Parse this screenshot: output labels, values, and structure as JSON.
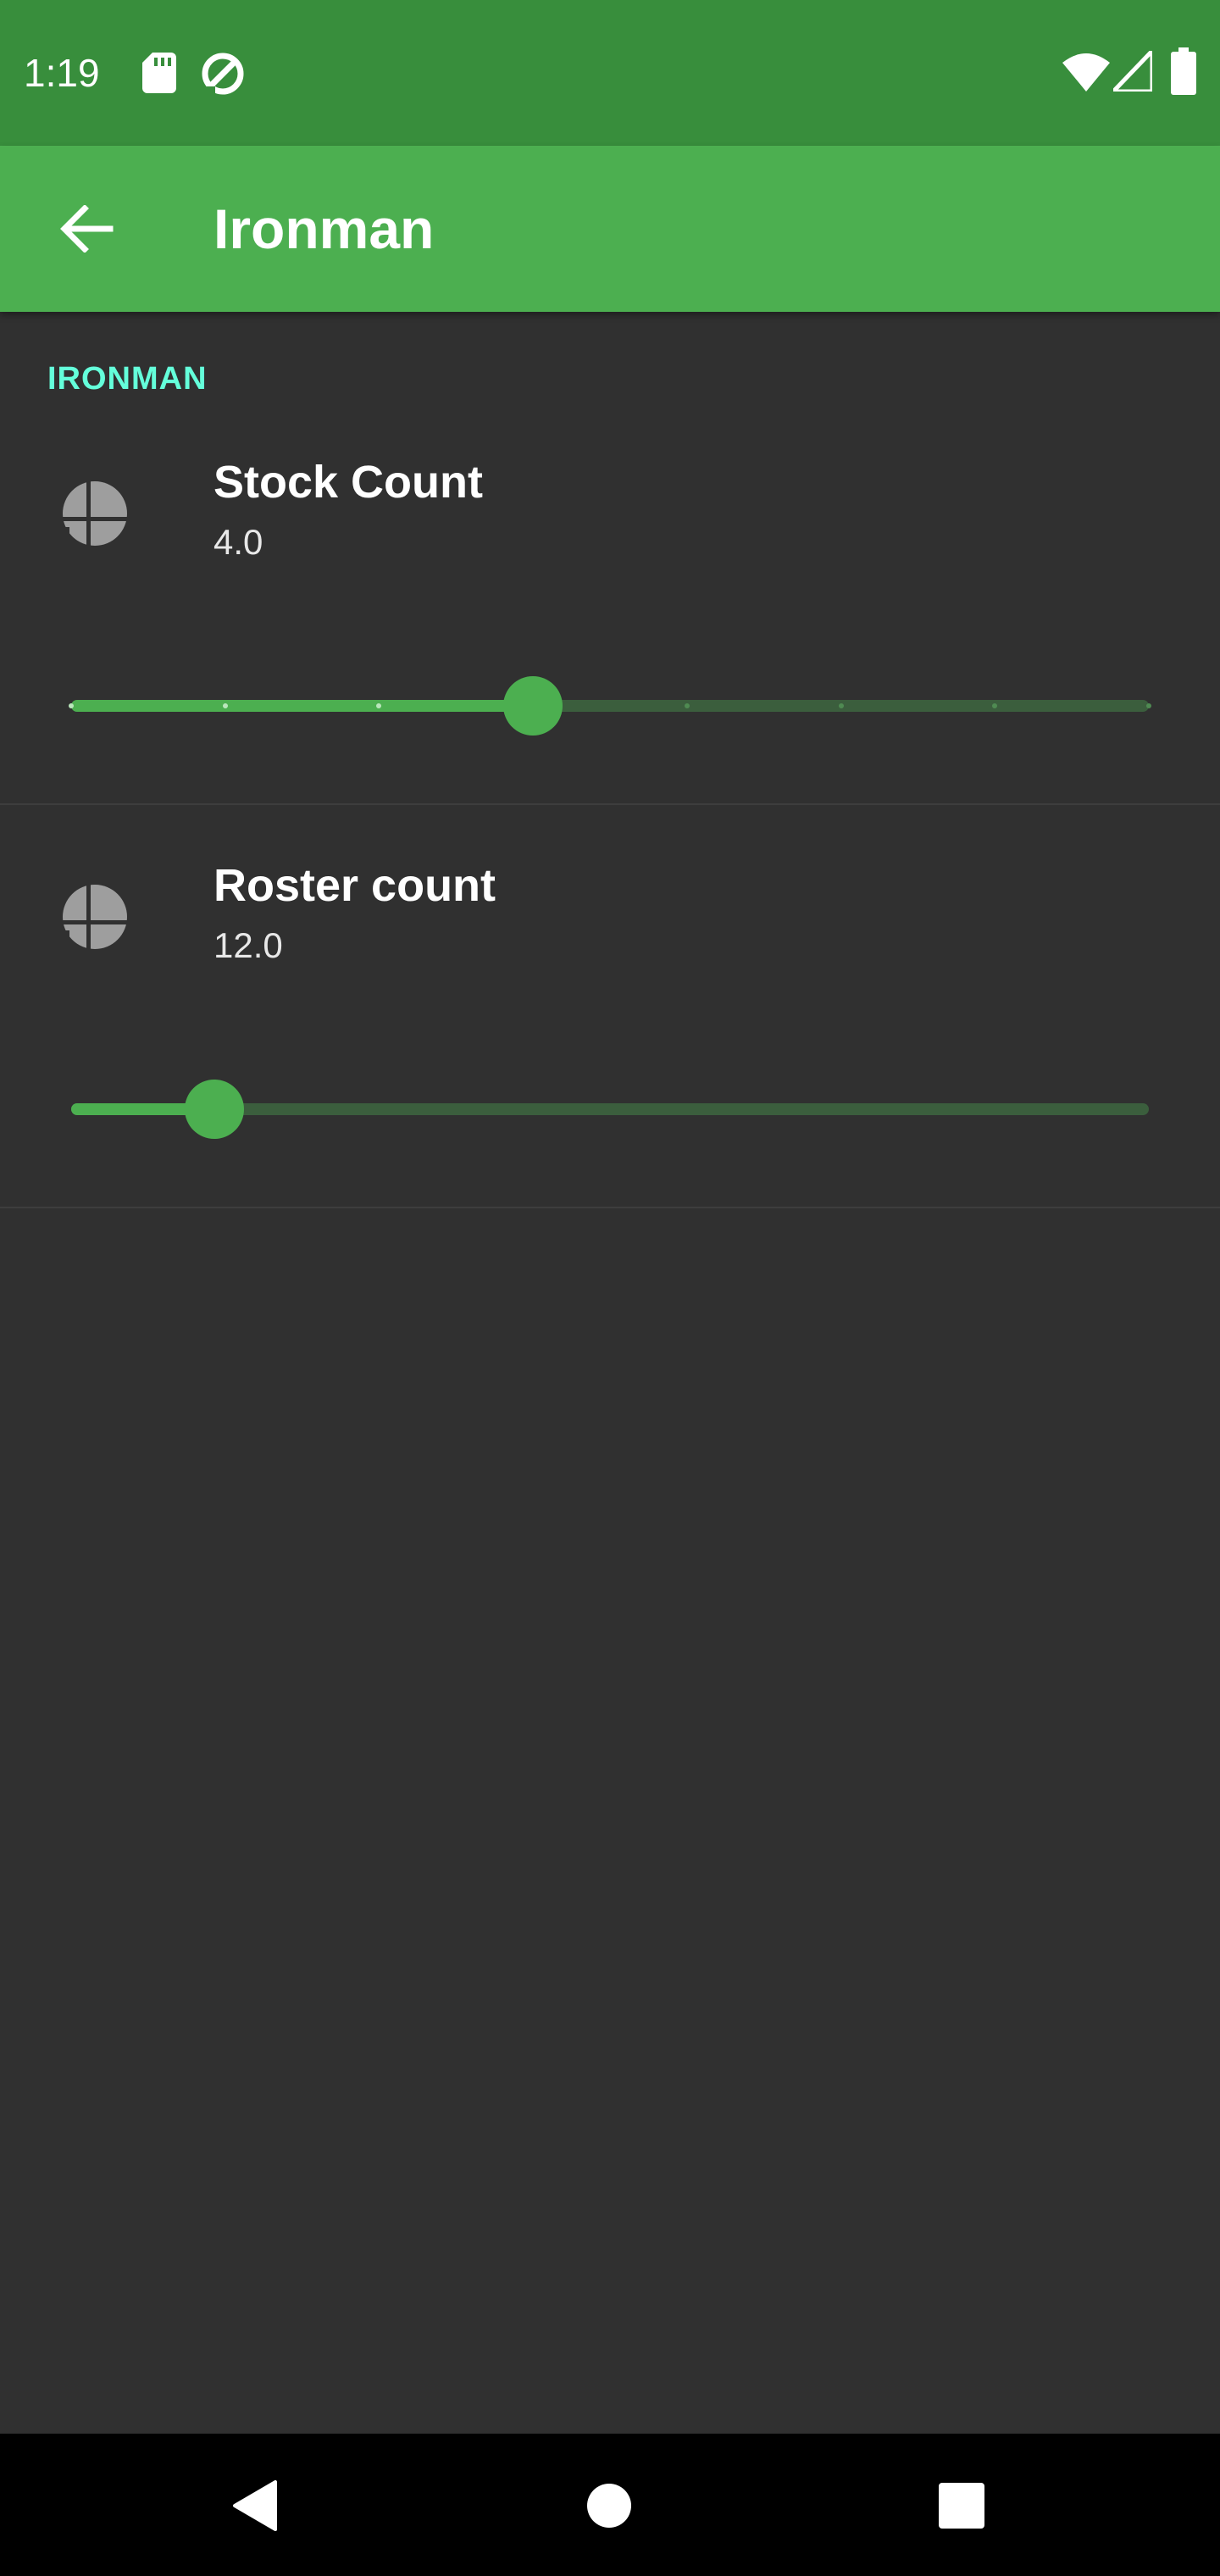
{
  "status_bar": {
    "time": "1:19",
    "left_icons": [
      "sd-card-icon",
      "data-saver-icon"
    ],
    "right_icons": [
      "wifi-icon",
      "cell-signal-icon",
      "battery-icon"
    ]
  },
  "app_bar": {
    "title": "Ironman",
    "back_icon": "arrow-back-icon"
  },
  "section": {
    "header": "IRONMAN"
  },
  "preferences": [
    {
      "title": "Stock Count",
      "summary": "4.0",
      "icon": "smash-ball-icon",
      "slider": {
        "value": 4,
        "min": 1,
        "max": 8,
        "discrete": true
      }
    },
    {
      "title": "Roster count",
      "summary": "12.0",
      "icon": "smash-ball-icon",
      "slider": {
        "value": 12,
        "min": 1,
        "max": 84,
        "discrete": false
      }
    }
  ],
  "nav_bar": {
    "buttons": [
      "back-triangle-icon",
      "home-circle-icon",
      "recents-square-icon"
    ]
  },
  "colors": {
    "status_bar": "#388e3c",
    "app_bar": "#4caf50",
    "accent": "#64ffda",
    "background": "#303030",
    "slider_active": "#4caf50",
    "slider_inactive": "#3b5e3d"
  }
}
